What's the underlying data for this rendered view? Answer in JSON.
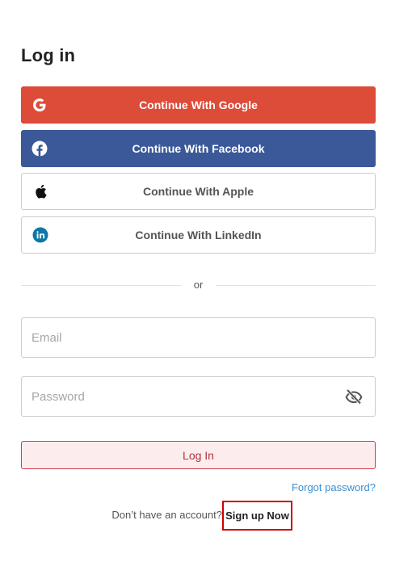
{
  "page": {
    "title": "Log in"
  },
  "social": {
    "google": {
      "label": "Continue With Google",
      "icon": "google-icon",
      "color": "#dd4b39"
    },
    "facebook": {
      "label": "Continue With Facebook",
      "icon": "facebook-icon",
      "color": "#3b5998"
    },
    "apple": {
      "label": "Continue With Apple",
      "icon": "apple-icon"
    },
    "linkedin": {
      "label": "Continue With LinkedIn",
      "icon": "linkedin-icon",
      "color": "#0e76a8"
    }
  },
  "divider": {
    "text": "or"
  },
  "form": {
    "email": {
      "value": "",
      "placeholder": "Email"
    },
    "password": {
      "value": "",
      "placeholder": "Password",
      "toggle_icon": "eye-off-icon"
    },
    "login_label": "Log In",
    "forgot_label": "Forgot password?"
  },
  "signup": {
    "prompt": "Don’t have an account?",
    "link_label": "Sign up Now"
  },
  "colors": {
    "accent_red": "#d33a4a",
    "link_blue": "#3d8fd1",
    "highlight_border": "#cc0000"
  }
}
